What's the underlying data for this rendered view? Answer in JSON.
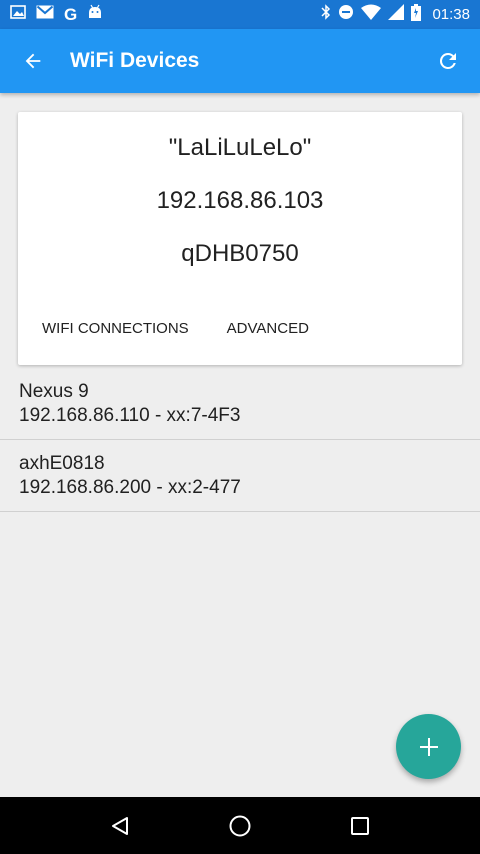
{
  "status_bar": {
    "time": "01:38",
    "left_icons": [
      "image-icon",
      "gmail-icon",
      "google-icon",
      "android-icon"
    ],
    "right_icons": [
      "bluetooth-icon",
      "do-not-disturb-icon",
      "wifi-icon",
      "signal-icon",
      "battery-icon"
    ],
    "google_glyph": "G"
  },
  "app_bar": {
    "title": "WiFi Devices",
    "back_icon": "arrow-left-icon",
    "refresh_icon": "refresh-icon"
  },
  "card": {
    "ssid": "\"LaLiLuLeLo\"",
    "ip": "192.168.86.103",
    "name": "qDHB0750",
    "actions": [
      "WIFI CONNECTIONS",
      "ADVANCED"
    ]
  },
  "devices": [
    {
      "name": "Nexus 9",
      "detail": "192.168.86.110 - xx:7-4F3"
    },
    {
      "name": "axhE0818",
      "detail": "192.168.86.200 - xx:2-477"
    }
  ],
  "fab": {
    "icon": "plus-icon"
  },
  "nav_bar": {
    "icons": [
      "back-triangle-icon",
      "home-circle-icon",
      "recents-square-icon"
    ]
  },
  "colors": {
    "status_bar": "#1976d2",
    "app_bar": "#2196f3",
    "fab": "#26a69a",
    "background": "#eeeeee"
  }
}
